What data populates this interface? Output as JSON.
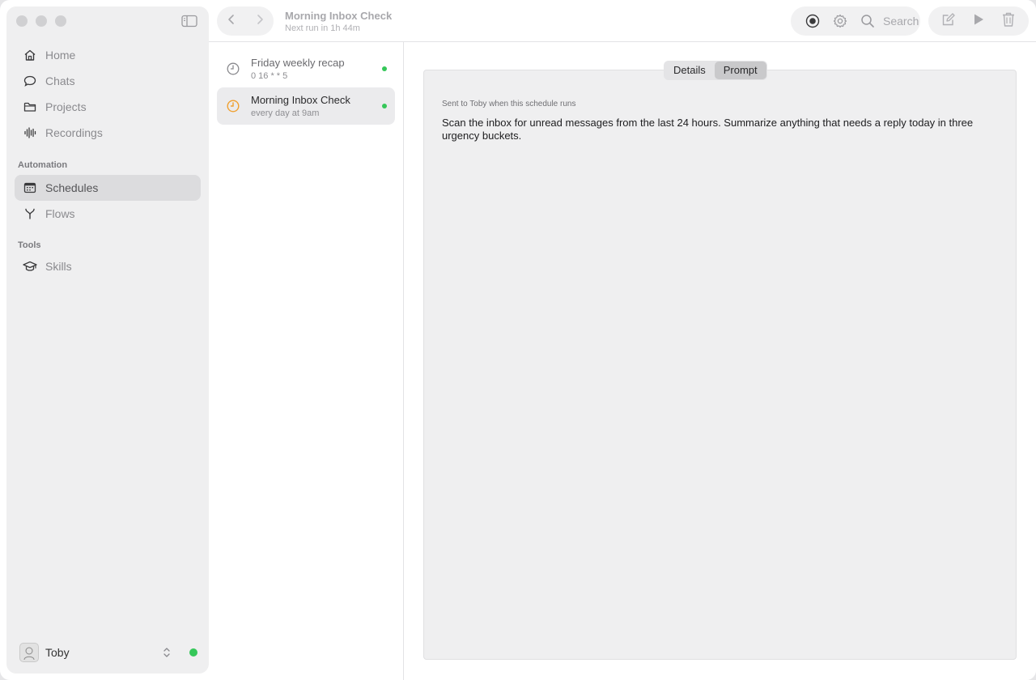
{
  "window": {
    "title": "Morning Inbox Check",
    "subtitle": "Next run in 1h 44m"
  },
  "sidebar": {
    "items": [
      {
        "label": "Home",
        "icon": "home-icon"
      },
      {
        "label": "Chats",
        "icon": "chat-bubble-icon"
      },
      {
        "label": "Projects",
        "icon": "folder-icon"
      },
      {
        "label": "Recordings",
        "icon": "waveform-icon"
      }
    ],
    "automation_label": "Automation",
    "automation_items": [
      {
        "label": "Schedules",
        "icon": "calendar-icon",
        "active": true
      },
      {
        "label": "Flows",
        "icon": "branch-icon"
      }
    ],
    "tools_label": "Tools",
    "tools_items": [
      {
        "label": "Skills",
        "icon": "graduation-cap-icon"
      }
    ],
    "user": {
      "name": "Toby",
      "status_color": "#35c759"
    }
  },
  "toolbar": {
    "search_label": "Search"
  },
  "schedules": [
    {
      "name": "Friday weekly recap",
      "schedule": "0 16 * * 5",
      "enabled": true
    },
    {
      "name": "Morning Inbox Check",
      "schedule": "every day at 9am",
      "enabled": true,
      "selected": true
    }
  ],
  "detail": {
    "tabs": [
      {
        "label": "Details"
      },
      {
        "label": "Prompt",
        "active": true
      }
    ],
    "prompt_caption": "Sent to Toby when this schedule runs",
    "prompt_text": "Scan the inbox for unread messages from the last 24 hours. Summarize anything that needs a reply today in three urgency buckets."
  },
  "colors": {
    "accent_orange": "#f0a030",
    "status_green": "#35c759"
  }
}
